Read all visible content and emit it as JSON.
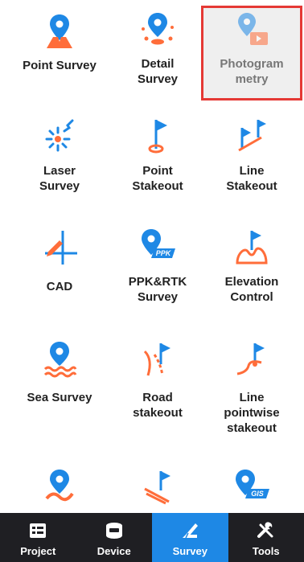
{
  "colors": {
    "accent_blue": "#1e88e5",
    "accent_orange": "#ff6d3a",
    "tabbar_bg": "#1f1f23",
    "selected_outline": "#e53935"
  },
  "tiles": [
    {
      "label": "Point Survey",
      "icon": "point-survey-icon"
    },
    {
      "label": "Detail\nSurvey",
      "icon": "detail-survey-icon"
    },
    {
      "label": "Photogram\nmetry",
      "icon": "photogrammetry-icon",
      "selected": true
    },
    {
      "label": "Laser\nSurvey",
      "icon": "laser-survey-icon"
    },
    {
      "label": "Point\nStakeout",
      "icon": "point-stakeout-icon"
    },
    {
      "label": "Line\nStakeout",
      "icon": "line-stakeout-icon"
    },
    {
      "label": "CAD",
      "icon": "cad-icon"
    },
    {
      "label": "PPK&RTK\nSurvey",
      "icon": "ppk-rtk-icon",
      "badge": "PPK"
    },
    {
      "label": "Elevation\nControl",
      "icon": "elevation-control-icon"
    },
    {
      "label": "Sea Survey",
      "icon": "sea-survey-icon"
    },
    {
      "label": "Road\nstakeout",
      "icon": "road-stakeout-icon"
    },
    {
      "label": "Line\npointwise\nstakeout",
      "icon": "line-pointwise-stakeout-icon"
    },
    {
      "label": "",
      "icon": "route-pin-icon"
    },
    {
      "label": "",
      "icon": "slope-stakeout-icon"
    },
    {
      "label": "",
      "icon": "gis-icon",
      "badge": "GIS"
    }
  ],
  "tabs": [
    {
      "label": "Project",
      "icon": "project-icon"
    },
    {
      "label": "Device",
      "icon": "device-icon"
    },
    {
      "label": "Survey",
      "icon": "survey-icon",
      "active": true
    },
    {
      "label": "Tools",
      "icon": "tools-icon"
    }
  ]
}
